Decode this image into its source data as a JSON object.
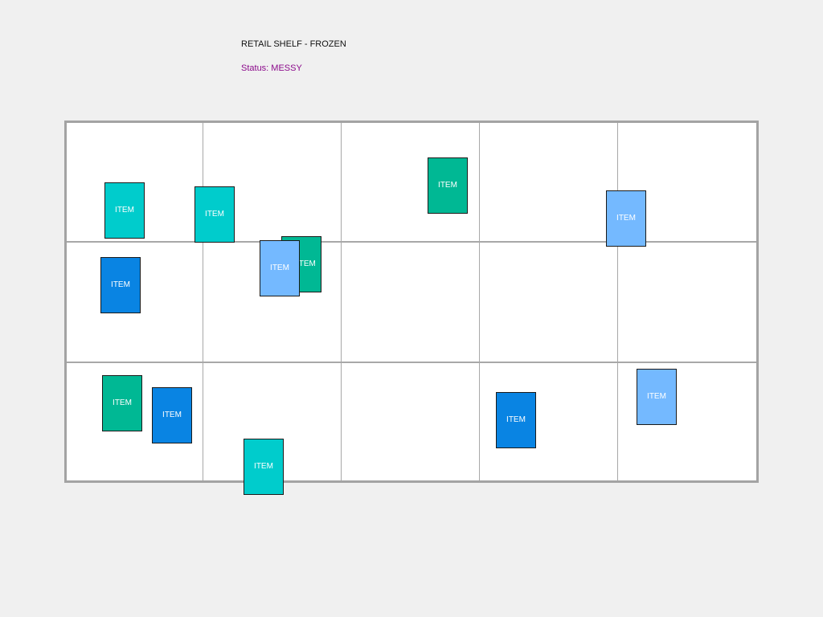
{
  "header": {
    "title": "RETAIL SHELF - FROZEN",
    "status": "Status: MESSY",
    "status_color": "#8b0a8b"
  },
  "colors": {
    "teal": "#00cccc",
    "green": "#00b894",
    "blue": "#0984e3",
    "lightblue": "#74b9ff"
  },
  "items": [
    {
      "label": "ITEM",
      "color": "#00cccc"
    },
    {
      "label": "ITEM",
      "color": "#00cccc"
    },
    {
      "label": "ITEM",
      "color": "#00b894"
    },
    {
      "label": "ITEM",
      "color": "#74b9ff"
    },
    {
      "label": "ITEM",
      "color": "#0984e3"
    },
    {
      "label": "ITEM",
      "color": "#00b894"
    },
    {
      "label": "ITEM",
      "color": "#74b9ff"
    },
    {
      "label": "ITEM",
      "color": "#00b894"
    },
    {
      "label": "ITEM",
      "color": "#0984e3"
    },
    {
      "label": "ITEM",
      "color": "#00cccc"
    },
    {
      "label": "ITEM",
      "color": "#0984e3"
    },
    {
      "label": "ITEM",
      "color": "#74b9ff"
    }
  ]
}
